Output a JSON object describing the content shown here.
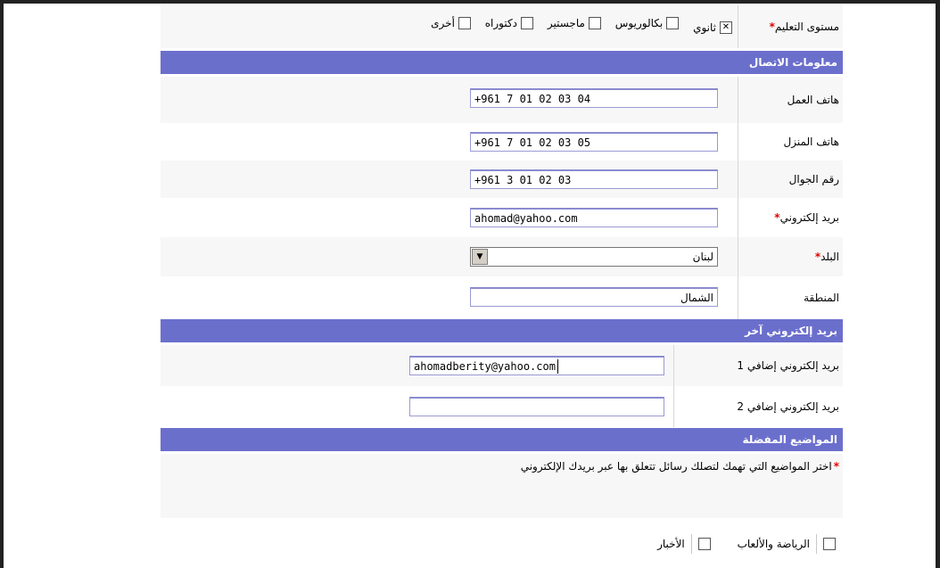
{
  "education": {
    "label": "مستوى التعليم",
    "options": [
      {
        "label": "ثانوي",
        "checked": true
      },
      {
        "label": "بكالوريوس",
        "checked": false
      },
      {
        "label": "ماجستير",
        "checked": false
      },
      {
        "label": "دكتوراه",
        "checked": false
      },
      {
        "label": "أخرى",
        "checked": false
      }
    ]
  },
  "contact_section": {
    "title": "معلومات الاتصال",
    "work_phone": {
      "label": "هاتف العمل",
      "value": "+961 7 01 02 03 04"
    },
    "home_phone": {
      "label": "هاتف المنزل",
      "value": "+961 7 01 02 03 05"
    },
    "mobile": {
      "label": "رقم الجوال",
      "value": "+961 3 01 02 03"
    },
    "email": {
      "label": "بريد إلكتروني",
      "value": "ahomad@yahoo.com"
    },
    "country": {
      "label": "البلد",
      "value": "لبنان"
    },
    "region": {
      "label": "المنطقة",
      "value": "الشمال"
    }
  },
  "emails_section": {
    "title": "بريد إلكتروني آخر",
    "email1": {
      "label": "بريد إلكتروني إضافي 1",
      "value": "ahomadberity@yahoo.com"
    },
    "email2": {
      "label": "بريد إلكتروني إضافي 2",
      "value": ""
    }
  },
  "interests_section": {
    "title": "المواضيع المفضلة",
    "note": "اختر المواضيع التي تهمك لتصلك رسائل تتعلق بها عبر بريدك الإلكتروني"
  },
  "interests": [
    {
      "label": "الرياضة والألعاب",
      "checked": false
    },
    {
      "label": "الأخبار",
      "checked": false
    }
  ],
  "colors": {
    "section_bg": "#6b6fcc",
    "required": "#e00000",
    "input_border": "#9a9ad4"
  }
}
